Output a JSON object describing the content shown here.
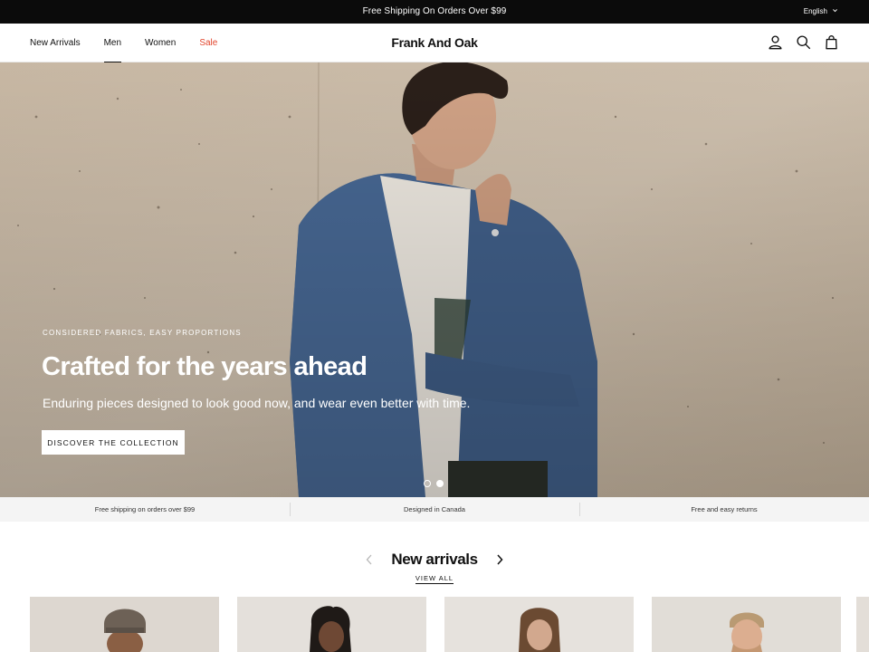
{
  "announcement": {
    "text": "Free Shipping On Orders Over $99",
    "language": "English"
  },
  "header": {
    "nav": [
      {
        "label": "New Arrivals",
        "active": false
      },
      {
        "label": "Men",
        "active": true
      },
      {
        "label": "Women",
        "active": false
      },
      {
        "label": "Sale",
        "active": false
      }
    ],
    "logo": "Frank And Oak",
    "icons": [
      "account-icon",
      "search-icon",
      "cart-icon"
    ]
  },
  "hero": {
    "eyebrow": "CONSIDERED FABRICS, EASY PROPORTIONS",
    "headline": "Crafted for the years ahead",
    "subline": "Enduring pieces designed to look good now, and wear even better with time.",
    "cta": "DISCOVER THE COLLECTION",
    "slides": 2,
    "active_slide": 2
  },
  "usp": [
    "Free shipping on orders over $99",
    "Designed in Canada",
    "Free and easy returns"
  ],
  "new_arrivals": {
    "title": "New arrivals",
    "view_all": "VIEW ALL"
  },
  "colors": {
    "sale": "#e2462d",
    "announcement_bg": "#0b0b0b",
    "usp_bg": "#f4f4f4"
  }
}
